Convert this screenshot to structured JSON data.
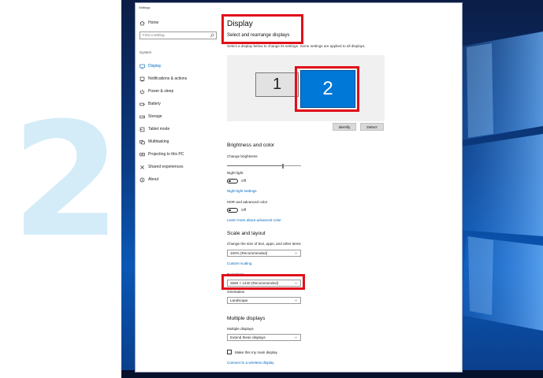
{
  "background": {
    "step_number": "2"
  },
  "window": {
    "title": "Settings"
  },
  "sidebar": {
    "home_label": "Home",
    "search_placeholder": "Find a setting",
    "group_label": "System",
    "items": [
      {
        "label": "Display",
        "icon": "monitor-icon",
        "active": true
      },
      {
        "label": "Notifications & actions",
        "icon": "notifications-icon"
      },
      {
        "label": "Power & sleep",
        "icon": "power-icon"
      },
      {
        "label": "Battery",
        "icon": "battery-icon"
      },
      {
        "label": "Storage",
        "icon": "storage-icon"
      },
      {
        "label": "Tablet mode",
        "icon": "tablet-icon"
      },
      {
        "label": "Multitasking",
        "icon": "multitasking-icon"
      },
      {
        "label": "Projecting to this PC",
        "icon": "projecting-icon"
      },
      {
        "label": "Shared experiences",
        "icon": "shared-experiences-icon"
      },
      {
        "label": "About",
        "icon": "info-icon"
      }
    ]
  },
  "main": {
    "title": "Display",
    "subtitle": "Select and rearrange displays",
    "helper": "Select a display below to change its settings. Some settings are applied to all displays.",
    "monitors": [
      "1",
      "2"
    ],
    "selected_monitor": "2",
    "identify_label": "Identify",
    "detect_label": "Detect",
    "brightness": {
      "heading": "Brightness and color",
      "label": "Change brightness",
      "level": 0.75,
      "night_light_label": "Night light",
      "night_light_state": "Off",
      "night_light_link": "Night light settings"
    },
    "hdr": {
      "label": "HDR and advanced color",
      "state": "Off",
      "link": "Learn more about advanced color"
    },
    "scale": {
      "heading": "Scale and layout",
      "label": "Change the size of text, apps, and other items",
      "value": "100% (Recommended)",
      "custom_link": "Custom scaling",
      "resolution_label": "Resolution",
      "resolution_value": "2560 × 1440 (Recommended)",
      "orientation_label": "Orientation",
      "orientation_value": "Landscape"
    },
    "multiple": {
      "heading": "Multiple displays",
      "label": "Multiple displays",
      "value": "Extend these displays",
      "main_display_label": "Make this my main display",
      "wireless_link": "Connect to a wireless display"
    }
  },
  "colors": {
    "accent": "#0078d7",
    "link": "#0067c0",
    "highlight": "#e0101a",
    "step_number": "#d4ecf8"
  }
}
